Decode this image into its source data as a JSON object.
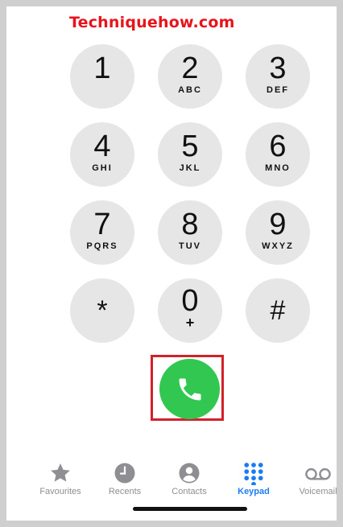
{
  "watermark": "Techniquehow.com",
  "keypad": [
    {
      "digit": "1",
      "letters": ""
    },
    {
      "digit": "2",
      "letters": "ABC"
    },
    {
      "digit": "3",
      "letters": "DEF"
    },
    {
      "digit": "4",
      "letters": "GHI"
    },
    {
      "digit": "5",
      "letters": "JKL"
    },
    {
      "digit": "6",
      "letters": "MNO"
    },
    {
      "digit": "7",
      "letters": "PQRS"
    },
    {
      "digit": "8",
      "letters": "TUV"
    },
    {
      "digit": "9",
      "letters": "WXYZ"
    },
    {
      "digit": "*",
      "letters": ""
    },
    {
      "digit": "0",
      "letters": "+"
    },
    {
      "digit": "#",
      "letters": ""
    }
  ],
  "call_button": {
    "icon": "phone-icon",
    "color": "#31c751",
    "highlight_color": "#d3212a"
  },
  "tabs": [
    {
      "label": "Favourites",
      "icon": "star-icon"
    },
    {
      "label": "Recents",
      "icon": "clock-icon"
    },
    {
      "label": "Contacts",
      "icon": "person-icon"
    },
    {
      "label": "Keypad",
      "icon": "keypad-icon",
      "active": true
    },
    {
      "label": "Voicemail",
      "icon": "voicemail-icon"
    }
  ],
  "colors": {
    "accent": "#1a7cf5",
    "key_bg": "#e6e6e6",
    "inactive": "#8e8e93"
  }
}
